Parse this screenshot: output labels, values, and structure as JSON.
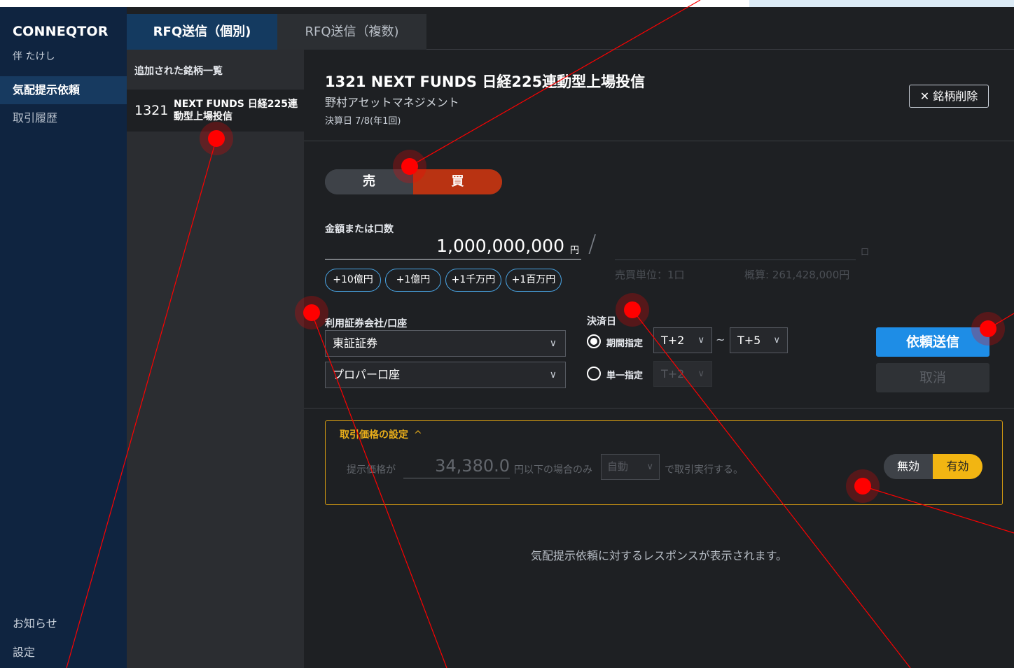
{
  "app": {
    "brand": "CONNEQTOR",
    "user": "伴 たけし"
  },
  "sidebar": {
    "items": [
      {
        "label": "気配提示依頼",
        "active": true
      },
      {
        "label": "取引履歴",
        "active": false
      }
    ],
    "bottom": [
      {
        "label": "お知らせ"
      },
      {
        "label": "設定"
      }
    ]
  },
  "tabs": [
    {
      "label": "RFQ送信（個別)",
      "active": true
    },
    {
      "label": "RFQ送信（複数)",
      "active": false
    }
  ],
  "list": {
    "heading": "追加された銘柄一覧",
    "items": [
      {
        "code": "1321",
        "name": "NEXT FUNDS 日経225連動型上場投信"
      }
    ]
  },
  "instrument": {
    "title": "1321 NEXT FUNDS 日経225連動型上場投信",
    "issuer": "野村アセットマネジメント",
    "settlement_info": "決算日 7/8(年1回)",
    "delete_label": "✕ 銘柄削除"
  },
  "side_toggle": {
    "sell": "売",
    "buy": "買",
    "selected": "buy"
  },
  "amount": {
    "label": "金額または口数",
    "value": "1,000,000,000",
    "unit": "円",
    "separator": "/",
    "units_value": "",
    "units_unit": "口",
    "lot_info": "売買単位：1口",
    "approx": "概算: 261,428,000円",
    "increments": [
      "+10億円",
      "+1億円",
      "+1千万円",
      "+1百万円"
    ]
  },
  "account": {
    "label": "利用証券会社/口座",
    "broker": "東証証券",
    "account": "プロパー口座"
  },
  "settlement": {
    "label": "決済日",
    "period_label": "期間指定",
    "period_from": "T+2",
    "period_separator": "~",
    "period_to": "T+5",
    "single_label": "単一指定",
    "single_value": "T+2",
    "selected": "period"
  },
  "actions": {
    "send": "依頼送信",
    "cancel": "取消"
  },
  "price_setting": {
    "title": "取引価格の設定",
    "caret": "^",
    "prefix": "提示価格が",
    "value": "34,380.0",
    "suffix": "円以下の場合のみ",
    "mode": "自動",
    "tail": "で取引実行する。",
    "off_label": "無効",
    "on_label": "有効",
    "enabled": true
  },
  "response_message": "気配提示依頼に対するレスポンスが表示されます。",
  "colors": {
    "accent_blue": "#1e8de6",
    "buy_red": "#b93312",
    "warning_gold": "#e8ad1a",
    "annotation_red": "#ff0000"
  }
}
